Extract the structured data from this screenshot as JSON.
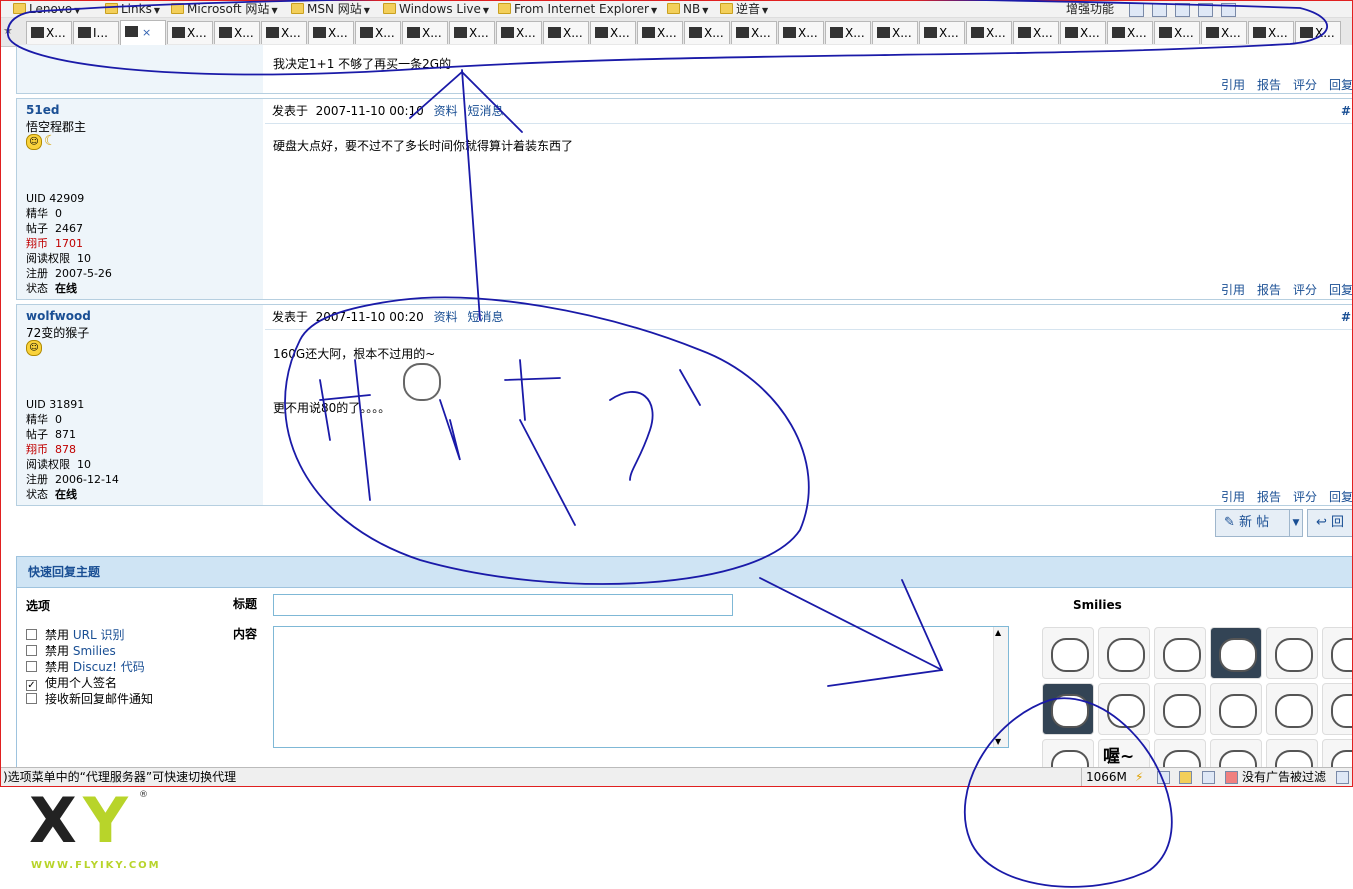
{
  "favorites": [
    "Lenovo",
    "Links",
    "Microsoft 网站",
    "MSN 网站",
    "Windows Live",
    "From Internet Explorer",
    "NB",
    "逆音"
  ],
  "toolbar_right": {
    "enhance_label": "增强功能"
  },
  "tabs": [
    {
      "label": "X...",
      "active": false
    },
    {
      "label": "I...",
      "active": false
    },
    {
      "label": "",
      "active": true,
      "close_glyph": "×"
    },
    {
      "label": "X...",
      "active": false
    },
    {
      "label": "X...",
      "active": false
    },
    {
      "label": "X...",
      "active": false
    },
    {
      "label": "X...",
      "active": false
    },
    {
      "label": "X...",
      "active": false
    },
    {
      "label": "X...",
      "active": false
    },
    {
      "label": "X...",
      "active": false
    },
    {
      "label": "X...",
      "active": false
    },
    {
      "label": "X...",
      "active": false
    },
    {
      "label": "X...",
      "active": false
    },
    {
      "label": "X...",
      "active": false
    },
    {
      "label": "X...",
      "active": false
    },
    {
      "label": "X...",
      "active": false
    },
    {
      "label": "X...",
      "active": false
    },
    {
      "label": "X...",
      "active": false
    },
    {
      "label": "X...",
      "active": false
    },
    {
      "label": "X...",
      "active": false
    },
    {
      "label": "X...",
      "active": false
    },
    {
      "label": "X...",
      "active": false
    },
    {
      "label": "X...",
      "active": false
    },
    {
      "label": "X...",
      "active": false
    },
    {
      "label": "X...",
      "active": false
    },
    {
      "label": "X...",
      "active": false
    },
    {
      "label": "X...",
      "active": false
    },
    {
      "label": "X...",
      "active": false
    }
  ],
  "first_post": {
    "message": "我决定1+1  不够了再买一条2G的",
    "actions": [
      "引用",
      "报告",
      "评分",
      "回复"
    ]
  },
  "posts": [
    {
      "username": "51ed",
      "user_title": "悟空程郡主",
      "stats": {
        "uid": "UID 42909",
        "digest_label": "精华",
        "digest": "0",
        "posts_label": "帖子",
        "posts": "2467",
        "coins_label": "翔币",
        "coins": "1701",
        "read_label": "阅读权限",
        "read": "10",
        "reg_label": "注册",
        "reg": "2007-5-26",
        "status_label": "状态",
        "status": "在线"
      },
      "posted_label": "发表于",
      "posted_time": "2007-11-10 00:10",
      "profile_link": "资料",
      "pm_link": "短消息",
      "floor": "#",
      "message_lines": [
        "硬盘大点好，要不过不了多长时间你就得算计着装东西了"
      ],
      "actions": [
        "引用",
        "报告",
        "评分",
        "回复"
      ]
    },
    {
      "username": "wolfwood",
      "user_title": "72变的猴子",
      "stats": {
        "uid": "UID 31891",
        "digest_label": "精华",
        "digest": "0",
        "posts_label": "帖子",
        "posts": "871",
        "coins_label": "翔币",
        "coins": "878",
        "read_label": "阅读权限",
        "read": "10",
        "reg_label": "注册",
        "reg": "2006-12-14",
        "status_label": "状态",
        "status": "在线"
      },
      "posted_label": "发表于",
      "posted_time": "2007-11-10 00:20",
      "profile_link": "资料",
      "pm_link": "短消息",
      "floor": "#",
      "message_lines": [
        "160G还大阿，根本不过用的~",
        "更不用说80的了。。。。"
      ],
      "actions": [
        "引用",
        "报告",
        "评分",
        "回复"
      ]
    }
  ],
  "post_buttons": {
    "new_thread": "新 帖",
    "reply": "回"
  },
  "quick_reply": {
    "header": "快速回复主题",
    "options_label": "选项",
    "title_label": "标题",
    "content_label": "内容",
    "smilies_label": "Smilies",
    "title_value": "",
    "content_value": "",
    "options": [
      {
        "label": "禁用 ",
        "link": "URL 识别",
        "checked": false
      },
      {
        "label": "禁用 ",
        "link": "Smilies",
        "checked": false
      },
      {
        "label": "禁用 ",
        "link": "Discuz! 代码",
        "checked": false
      },
      {
        "label": "使用个人签名",
        "link": "",
        "checked": true
      },
      {
        "label": "接收新回复邮件通知",
        "link": "",
        "checked": false
      }
    ],
    "check_glyph": "✓",
    "smiley_text": "喔~"
  },
  "statusbar": {
    "message": ")选项菜单中的“代理服务器”可快速切换代理",
    "memory": "1066M",
    "adblock": "没有广告被过滤"
  },
  "logo": {
    "letters_x": "X",
    "letters_y": "Y",
    "reg": "®",
    "url": "WWW.FLYIKY.COM"
  },
  "colors": {
    "accent": "#1a4f94",
    "ink": "#1a1aa8",
    "frame": "#e02020",
    "brand_green": "#b8d42a"
  }
}
